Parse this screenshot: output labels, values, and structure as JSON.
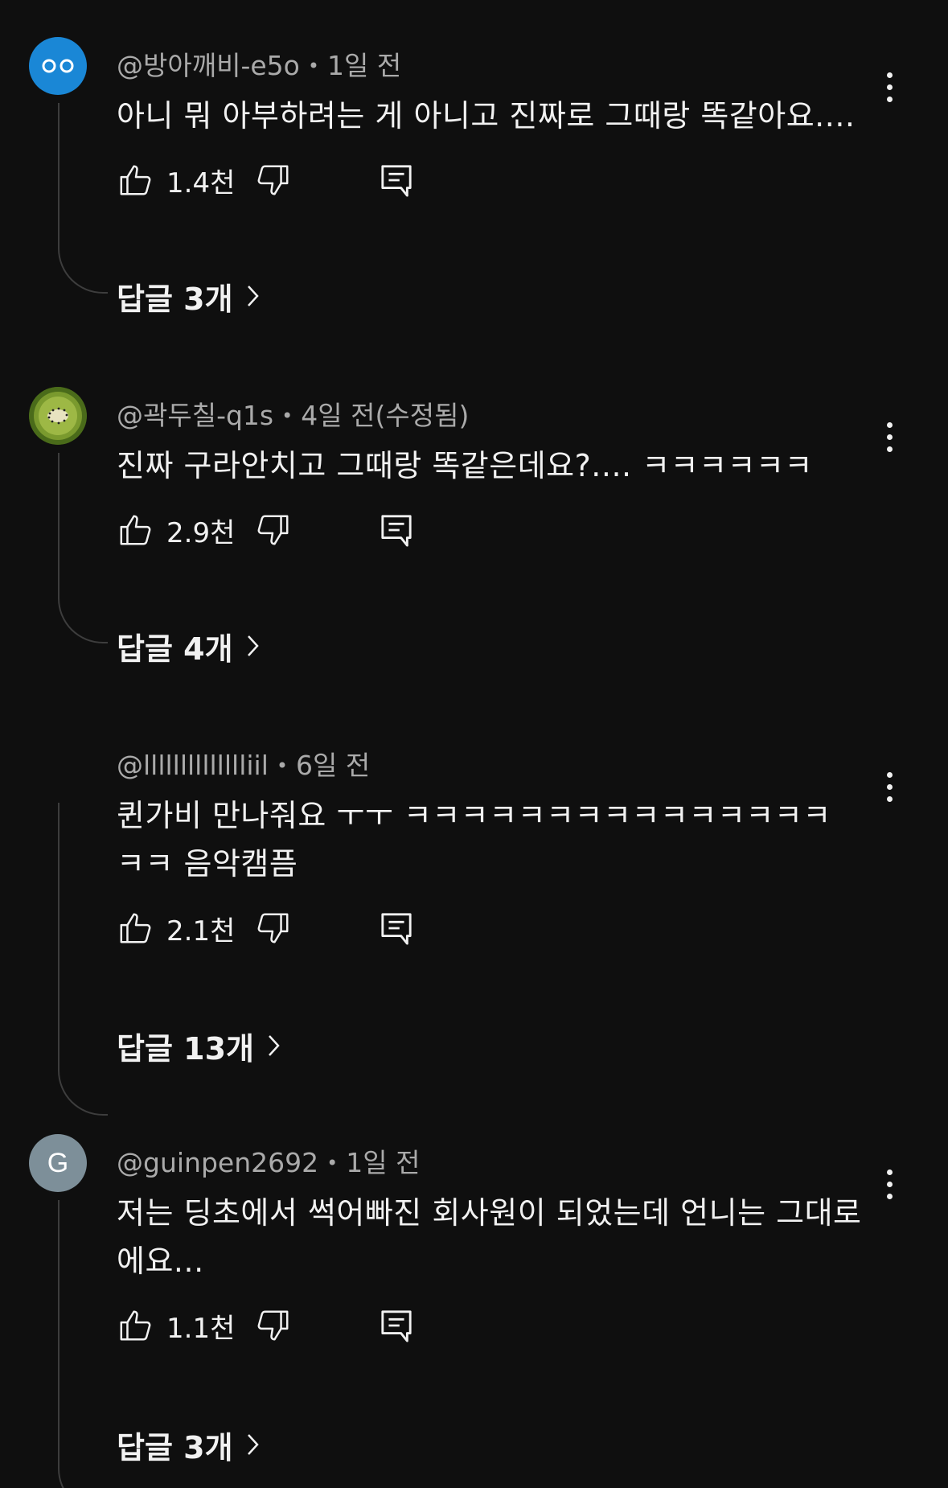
{
  "comments": [
    {
      "author": "@방아깨비-e5o",
      "time": "1일 전",
      "text": "아니 뭐 아부하려는 게 아니고 진짜로 그때랑 똑같아요....",
      "likes": "1.4천",
      "replies": "답글 3개",
      "avatar": {
        "type": "eyes",
        "color": "#1a87d6"
      }
    },
    {
      "author": "@곽두칠-q1s",
      "time": "4일 전(수정됨)",
      "text": "진짜 구라안치고 그때랑 똑같은데요?.... ㅋㅋㅋㅋㅋㅋ",
      "likes": "2.9천",
      "replies": "답글 4개",
      "avatar": {
        "type": "kiwi",
        "color": "#6b8a2a"
      }
    },
    {
      "author": "@lllllllllllllliil",
      "time": "6일 전",
      "text": "퀸가비 만나줘요 ㅜㅜ ㅋㅋㅋㅋㅋㅋㅋㅋㅋㅋㅋㅋㅋㅋㅋ ㅋㅋ 음악캠픔",
      "likes": "2.1천",
      "replies": "답글 13개",
      "avatar": {
        "type": "none",
        "color": ""
      }
    },
    {
      "author": "@guinpen2692",
      "time": "1일 전",
      "text": "저는 딩초에서 썩어빠진 회사원이 되었는데 언니는 그대로에요...",
      "likes": "1.1천",
      "replies": "답글 3개",
      "avatar": {
        "type": "letter",
        "letter": "G",
        "color": "#7d8f99"
      }
    }
  ],
  "icons": {
    "like": "thumbs-up-icon",
    "dislike": "thumbs-down-icon",
    "reply": "comment-icon",
    "more": "more-vert-icon",
    "chevron": "chevron-right-icon"
  },
  "colors": {
    "background": "#0f0f0f",
    "text": "#f1f1f1",
    "meta": "#aaaaaa",
    "thread_line": "#3d3d3d"
  }
}
